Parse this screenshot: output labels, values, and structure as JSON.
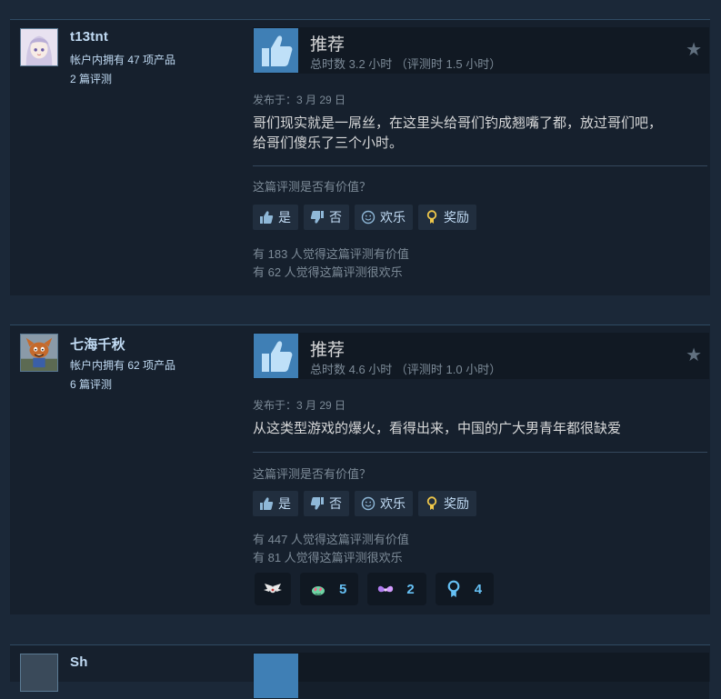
{
  "reviews": [
    {
      "persona": "t13tnt",
      "products": "帐户内拥有 47 项产品",
      "review_count": "2 篇评测",
      "recommendation": "推荐",
      "hours": "总时数 3.2 小时 （评测时 1.5 小时）",
      "posted": "发布于：3 月 29 日",
      "content_lines": [
        "哥们现实就是一屌丝，在这里头给哥们钓成翘嘴了都，放过哥们吧，",
        "给哥们傻乐了三个小时。"
      ],
      "helpful_question": "这篇评测是否有价值？",
      "buttons": {
        "yes": "是",
        "no": "否",
        "funny": "欢乐",
        "award": "奖励"
      },
      "found_helpful": "有 183 人觉得这篇评测有价值",
      "found_funny": "有 62 人觉得这篇评测很欢乐"
    },
    {
      "persona": "七海千秋",
      "products": "帐户内拥有 62 项产品",
      "review_count": "6 篇评测",
      "recommendation": "推荐",
      "hours": "总时数 4.6 小时 （评测时 1.0 小时）",
      "posted": "发布于：3 月 29 日",
      "content_lines": [
        "从这类型游戏的爆火，看得出来，中国的广大男青年都很缺爱"
      ],
      "helpful_question": "这篇评测是否有价值？",
      "buttons": {
        "yes": "是",
        "no": "否",
        "funny": "欢乐",
        "award": "奖励"
      },
      "found_helpful": "有 447 人觉得这篇评测有价值",
      "found_funny": "有 81 人觉得这篇评测很欢乐",
      "awards": [
        {
          "icon": "winged-award-icon",
          "count": ""
        },
        {
          "icon": "heart-eyes-award-icon",
          "count": "5"
        },
        {
          "icon": "wings-award-icon",
          "count": "2"
        },
        {
          "icon": "medal-award-icon",
          "count": "4"
        }
      ]
    }
  ],
  "next_review": {
    "persona": "Sh"
  },
  "colors": {
    "accent": "#66c0f4",
    "thumb": "#5aa0d8",
    "background": "#1b2838",
    "card": "#16202d"
  }
}
